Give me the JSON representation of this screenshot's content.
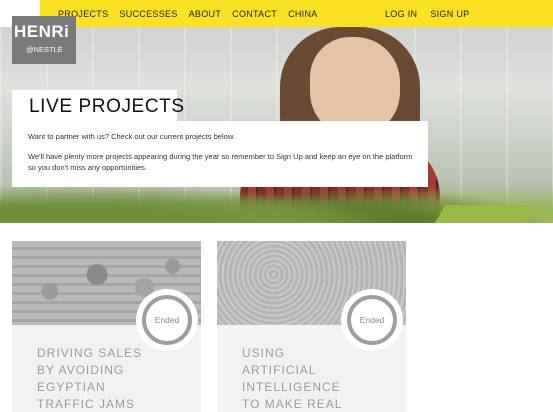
{
  "nav": {
    "left": [
      "PROJECTS",
      "SUCCESSES",
      "ABOUT",
      "CONTACT",
      "CHINA"
    ],
    "right": [
      "LOG IN",
      "SIGN UP"
    ]
  },
  "logo": {
    "brand": "HENRi",
    "sub": "@NESTLÉ"
  },
  "hero": {
    "title": "LIVE PROJECTS",
    "intro_1": "Want to partner with us? Check out our current projects below.",
    "intro_2": "We'll have plenty more projects appearing during the year so remember to Sign Up and keep an eye on the platform so you don't miss any opportunities."
  },
  "projects": [
    {
      "title": "DRIVING SALES BY AVOIDING EGYPTIAN TRAFFIC JAMS",
      "status": "Ended"
    },
    {
      "title": "USING ARTIFICIAL INTELLIGENCE TO MAKE REAL",
      "status": "Ended"
    }
  ],
  "colors": {
    "accent": "#f8e223",
    "logo_bg": "#7a7a7a",
    "card_bg": "#f2f2f2"
  }
}
